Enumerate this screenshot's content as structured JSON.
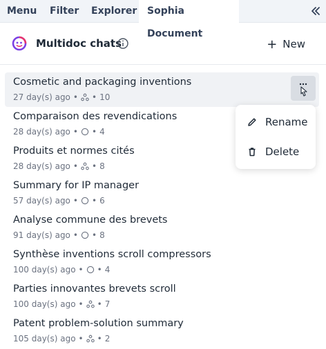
{
  "tabs": [
    {
      "label": "Menu",
      "active": false
    },
    {
      "label": "Filter",
      "active": false
    },
    {
      "label": "Explorer",
      "active": false
    },
    {
      "label": "Sophia Document",
      "active": true
    }
  ],
  "collapse_icon": "double-chevron-left-icon",
  "header": {
    "title": "Multidoc chats",
    "new_label": "New"
  },
  "chats": [
    {
      "title": "Cosmetic and packaging inventions",
      "age": "27 day(s) ago",
      "icon": "nodes-icon",
      "count": "10"
    },
    {
      "title": "Comparaison des revendications",
      "age": "28 day(s) ago",
      "icon": "circle-icon",
      "count": "4"
    },
    {
      "title": "Produits et normes cités",
      "age": "28 day(s) ago",
      "icon": "nodes-icon",
      "count": "8"
    },
    {
      "title": "Summary for IP manager",
      "age": "57 day(s) ago",
      "icon": "circle-icon",
      "count": "6"
    },
    {
      "title": "Analyse commune des brevets",
      "age": "91 day(s) ago",
      "icon": "circle-icon",
      "count": "8"
    },
    {
      "title": "Synthèse inventions scroll compressors",
      "age": "100 day(s) ago",
      "icon": "circle-icon",
      "count": "4"
    },
    {
      "title": "Parties innovantes brevets scroll",
      "age": "100 day(s) ago",
      "icon": "nodes-icon",
      "count": "7"
    },
    {
      "title": "Patent problem-solution summary",
      "age": "105 day(s) ago",
      "icon": "nodes-icon",
      "count": "2"
    }
  ],
  "context_menu": {
    "rename_label": "Rename",
    "delete_label": "Delete"
  },
  "colors": {
    "accent_logo_purple": "#7b3fe4",
    "accent_logo_pink": "#e8336d",
    "hover_bg": "#f0f2f5"
  }
}
